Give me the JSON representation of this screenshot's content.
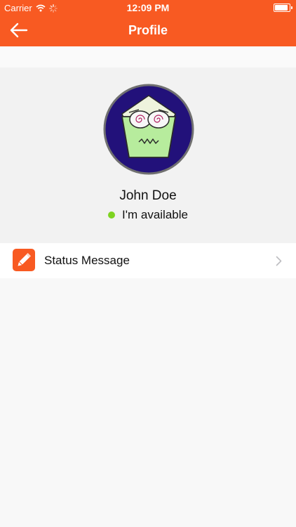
{
  "status_bar": {
    "carrier": "Carrier",
    "time": "12:09 PM",
    "battery_level": 1.0,
    "icons": [
      "wifi-icon",
      "activity-spinner-icon",
      "battery-icon"
    ]
  },
  "nav": {
    "title": "Profile",
    "back_icon": "arrow-left-icon"
  },
  "profile": {
    "name": "John Doe",
    "presence_text": "I'm available",
    "presence_color": "#7ed321",
    "avatar_icon": "cupcake-avatar-icon"
  },
  "list": {
    "items": [
      {
        "label": "Status Message",
        "icon": "pencil-icon",
        "icon_bg": "#f85a22",
        "trailing_icon": "chevron-right-icon"
      }
    ]
  },
  "colors": {
    "accent": "#f85a22",
    "background": "#f8f8f8",
    "card_background": "#f2f2f2",
    "row_background": "#ffffff"
  }
}
